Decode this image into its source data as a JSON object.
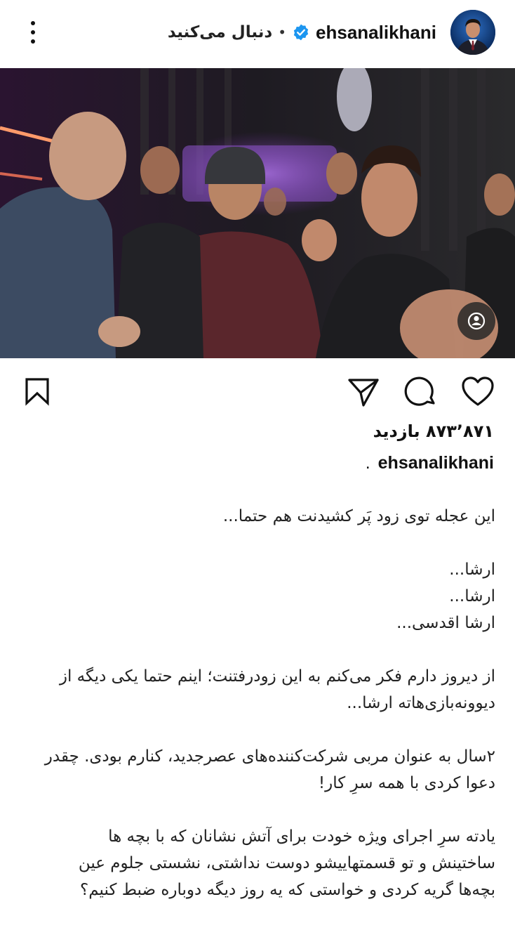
{
  "header": {
    "username": "ehsanalikhani",
    "follow_label": "دنبال می‌کنید",
    "separator": "•",
    "verified_icon": "verified-badge-icon",
    "more_icon": "more-vertical-icon"
  },
  "post": {
    "photo_icon": "user-tag-icon",
    "actions": {
      "like_icon": "heart-icon",
      "comment_icon": "comment-icon",
      "share_icon": "send-icon",
      "save_icon": "bookmark-icon"
    },
    "views": "۸۷۳٬۸۷۱ بازدید",
    "caption_user": "ehsanalikhani",
    "caption_dot": ".",
    "caption_paragraphs": [
      [
        "این عجله توی زود پَر کشیدنت هم حتما..."
      ],
      [
        "ارشا...",
        "ارشا...",
        "ارشا اقدسی..."
      ],
      [
        "از دیروز دارم فکر می‌کنم به این زودرفتنت؛ اینم حتما یکی دیگه از",
        "دیوونه‌بازی‌هاته ارشا..."
      ],
      [
        "۲سال به عنوان مربی شرکت‌کننده‌های عصرجدید، کنارم بودی. چقدر",
        "دعوا کردی با همه سرِ کار!"
      ],
      [
        "یادته سرِ اجرای ویژه خودت برای آتش نشانان که با بچه ها",
        "ساختینش و تو قسمتهاییشو دوست نداشتی، نشستی جلوم عین",
        "بچه‌ها گریه کردی و خواستی که یه روز دیگه دوباره ضبط کنیم؟"
      ]
    ]
  }
}
